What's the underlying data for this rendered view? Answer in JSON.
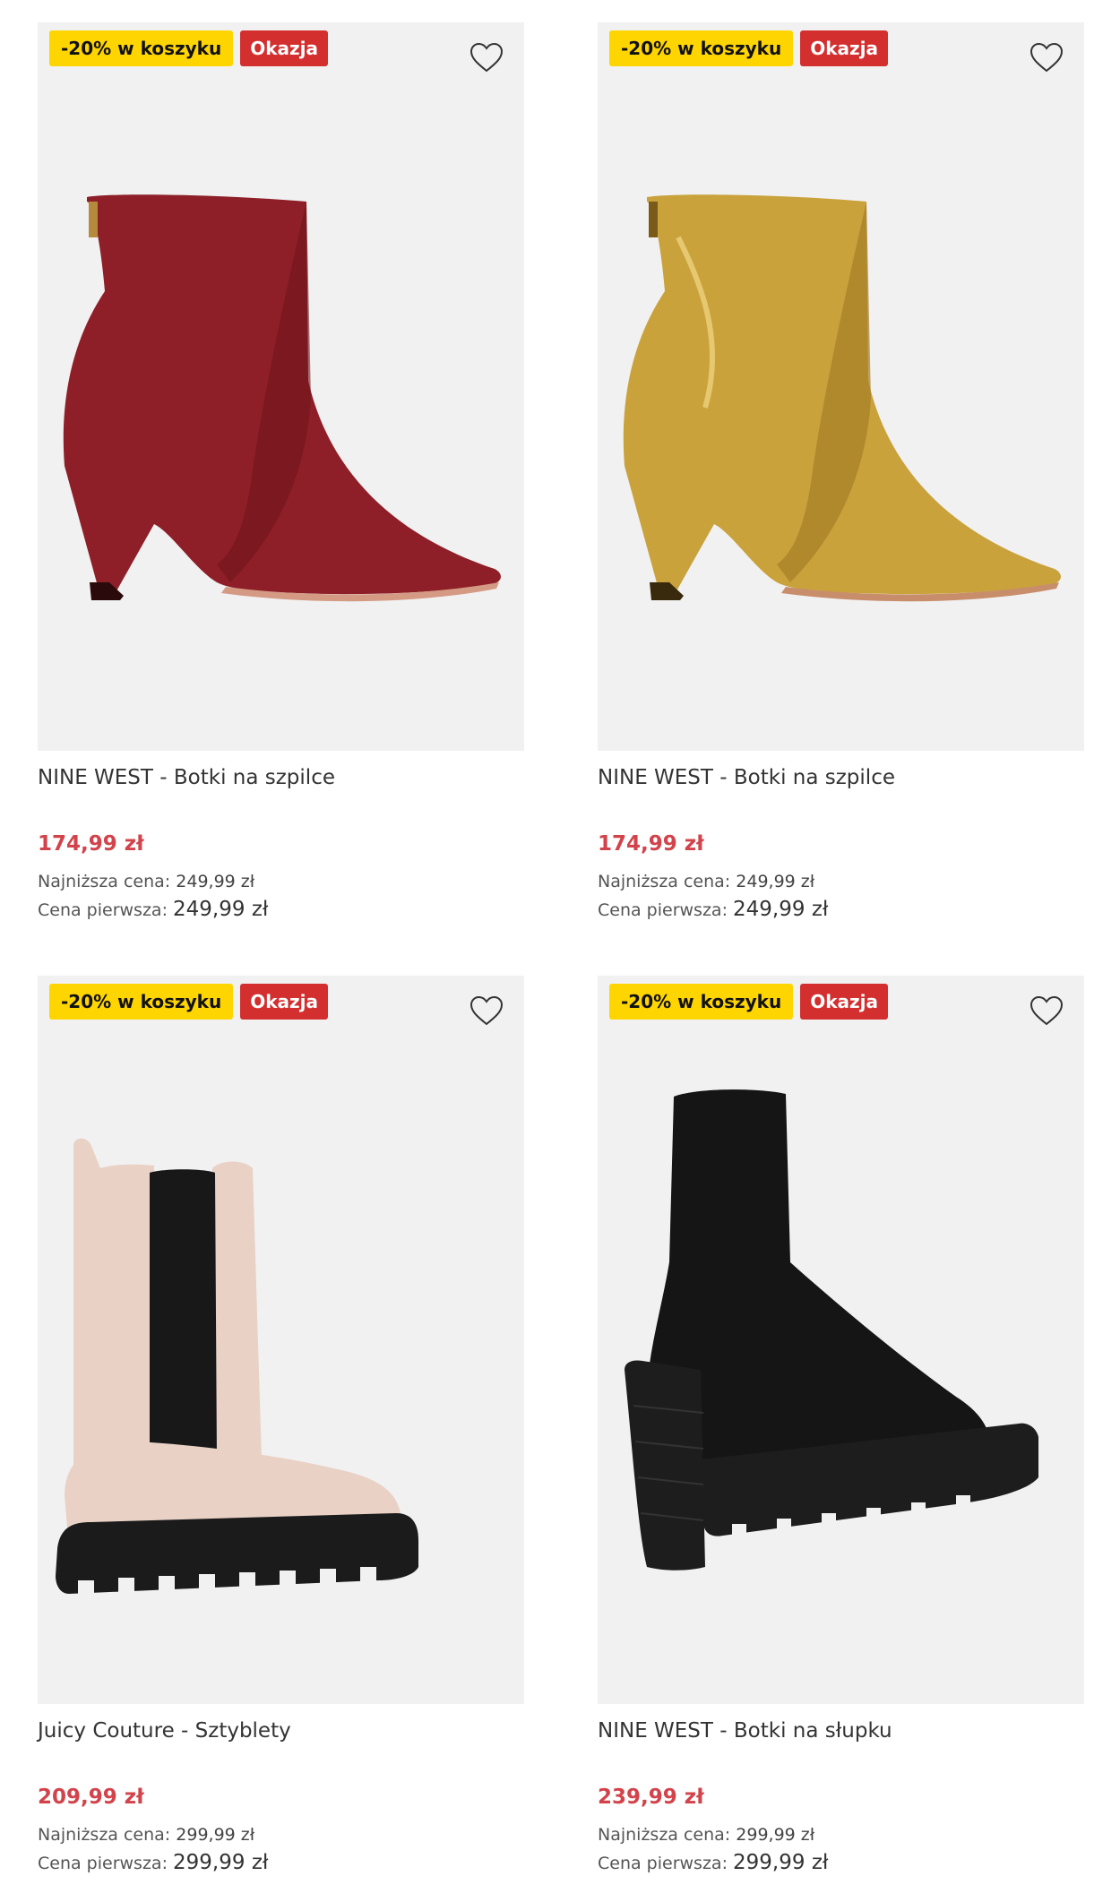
{
  "products": [
    {
      "badge_discount": "-20% w koszyku",
      "badge_deal": "Okazja",
      "title": "NINE WEST - Botki na szpilce",
      "price": "174,99 zł",
      "lowest_label": "Najniższa cena:",
      "lowest_value": "249,99 zł",
      "first_label": "Cena pierwsza:",
      "first_value": "249,99 zł",
      "color": "#8a1f26"
    },
    {
      "badge_discount": "-20% w koszyku",
      "badge_deal": "Okazja",
      "title": "NINE WEST - Botki na szpilce",
      "price": "174,99 zł",
      "lowest_label": "Najniższa cena:",
      "lowest_value": "249,99 zł",
      "first_label": "Cena pierwsza:",
      "first_value": "249,99 zł",
      "color": "#c9a23a"
    },
    {
      "badge_discount": "-20% w koszyku",
      "badge_deal": "Okazja",
      "title": "Juicy Couture - Sztyblety",
      "price": "209,99 zł",
      "lowest_label": "Najniższa cena:",
      "lowest_value": "299,99 zł",
      "first_label": "Cena pierwsza:",
      "first_value": "299,99 zł",
      "color": "#e8cfc4"
    },
    {
      "badge_discount": "-20% w koszyku",
      "badge_deal": "Okazja",
      "title": "NINE WEST - Botki na słupku",
      "price": "239,99 zł",
      "lowest_label": "Najniższa cena:",
      "lowest_value": "299,99 zł",
      "first_label": "Cena pierwsza:",
      "first_value": "299,99 zł",
      "color": "#111111"
    }
  ],
  "icons": {
    "favorite": "heart-outline-icon"
  },
  "colors": {
    "badge_yellow": "#ffd500",
    "badge_red": "#d32f2f",
    "price_red": "#d2434b",
    "image_bg": "#f1f1f1"
  }
}
